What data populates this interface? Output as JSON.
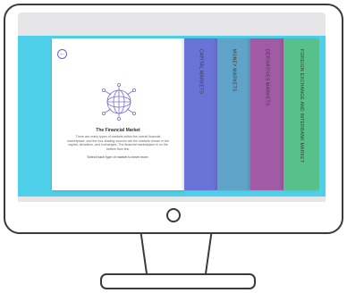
{
  "card": {
    "back_icon": "back-arrow-icon",
    "globe_icon": "globe-network-icon",
    "title": "The Financial Market",
    "description": "There are many types of markets within the overall financial marketplace, and the four leading sources are the markets shown in the capital, derivative, and exchanges. The financial marketplace is on the bottom floor link.",
    "hint": "Select each type of market to learn more."
  },
  "panels": [
    {
      "label": "CAPITAL MARKETS",
      "color": "#6a74d6"
    },
    {
      "label": "MONEY MARKETS",
      "color": "#5fa3c8"
    },
    {
      "label": "DERIVATIVES MARKETS",
      "color": "#a15ba4"
    },
    {
      "label": "FOREIGN EXCHANGE AND INTERBANK MARKET",
      "color": "#58c08a"
    }
  ],
  "colors": {
    "screen_background": "#4fd0ea",
    "accent": "#7060c8"
  }
}
